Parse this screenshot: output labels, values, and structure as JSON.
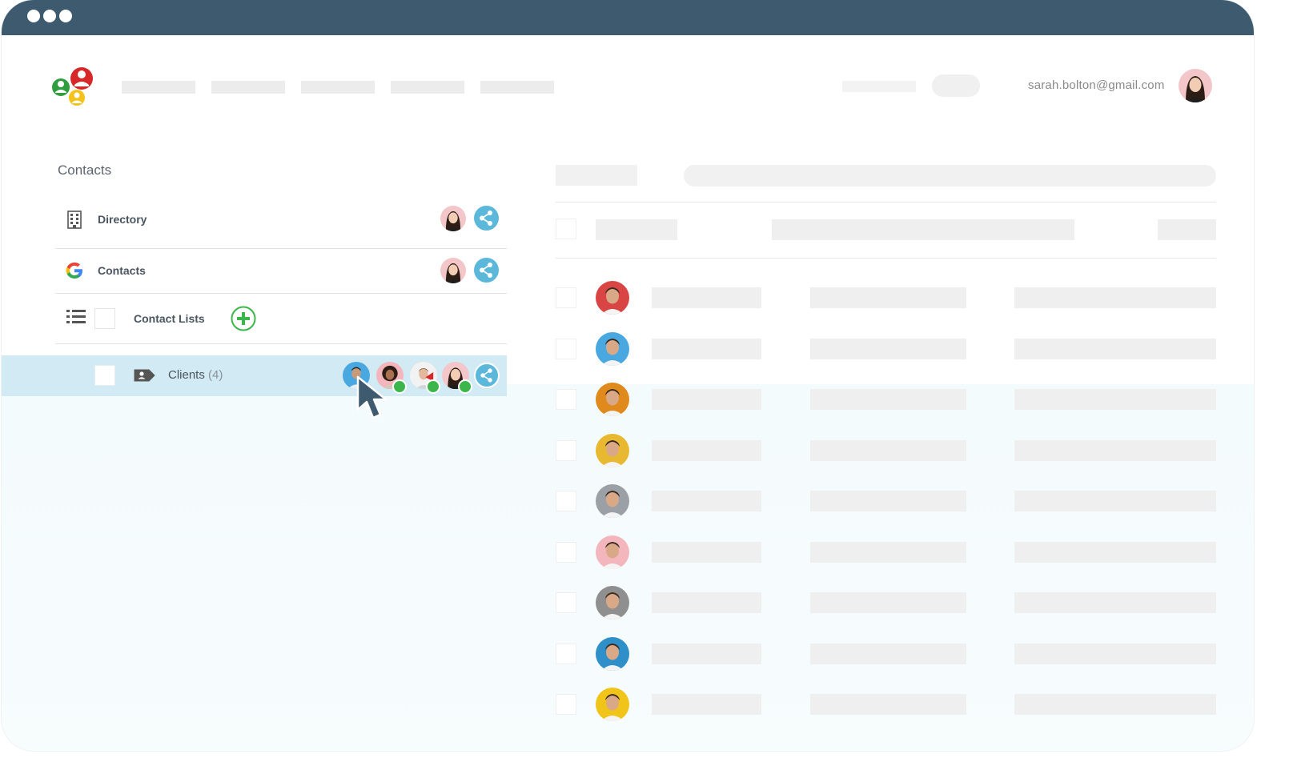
{
  "window": {
    "dots": 3
  },
  "header": {
    "user_email": "sarah.bolton@gmail.com",
    "logo_name": "app-logo"
  },
  "sidebar": {
    "title": "Contacts",
    "items": [
      {
        "label": "Directory",
        "icon": "building-icon"
      },
      {
        "label": "Contacts",
        "icon": "google-icon"
      },
      {
        "label": "Contact Lists",
        "icon": "list-icon"
      }
    ],
    "clients": {
      "label": "Clients",
      "count": "(4)",
      "icon": "contact-tag-icon"
    }
  },
  "colors": {
    "titlebar": "#3d5a6e",
    "share": "#5bb8db",
    "add": "#3cb54a",
    "selected_row": "#d2eaf3",
    "cursor": "#3d5a6e"
  },
  "table": {
    "row_avatar_colors": [
      "#d94545",
      "#4aa8e0",
      "#e08a1e",
      "#e8b830",
      "#9aa0a6",
      "#f4b6bd",
      "#8f8f8f",
      "#2e8fc9",
      "#f0c419"
    ]
  }
}
